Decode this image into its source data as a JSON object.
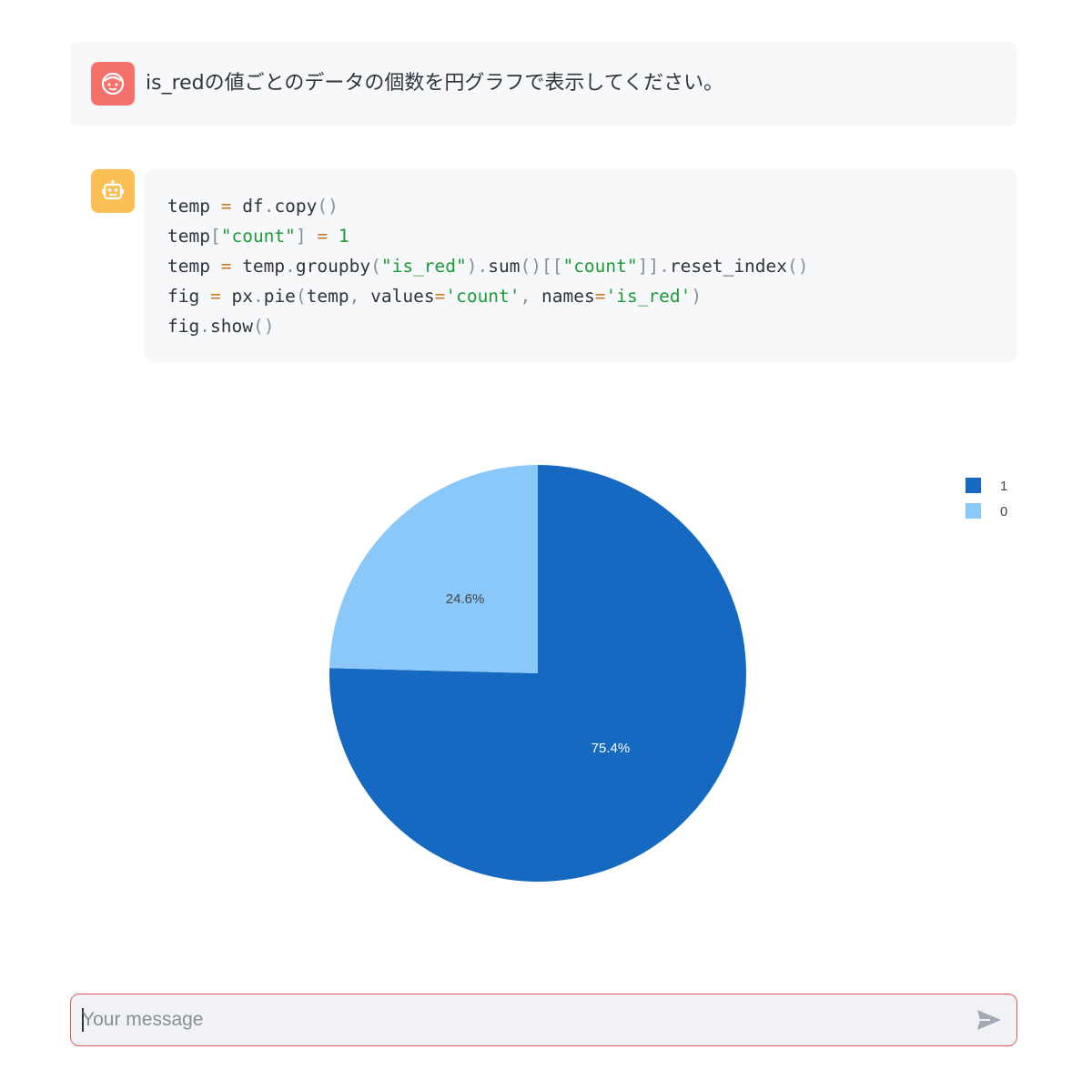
{
  "chat": {
    "user_message": "is_redの値ごとのデータの個数を円グラフで表示してください。",
    "user_avatar_icon": "face-icon",
    "bot_avatar_icon": "robot-icon",
    "code": {
      "lines": [
        [
          {
            "t": "temp ",
            "c": ""
          },
          {
            "t": "=",
            "c": "op"
          },
          {
            "t": " df",
            "c": ""
          },
          {
            "t": ".",
            "c": "punc"
          },
          {
            "t": "copy",
            "c": ""
          },
          {
            "t": "()",
            "c": "punc"
          }
        ],
        [
          {
            "t": "temp",
            "c": ""
          },
          {
            "t": "[",
            "c": "punc"
          },
          {
            "t": "\"count\"",
            "c": "str"
          },
          {
            "t": "] ",
            "c": "punc"
          },
          {
            "t": "=",
            "c": "op"
          },
          {
            "t": " ",
            "c": ""
          },
          {
            "t": "1",
            "c": "num"
          }
        ],
        [
          {
            "t": "temp ",
            "c": ""
          },
          {
            "t": "=",
            "c": "op"
          },
          {
            "t": " temp",
            "c": ""
          },
          {
            "t": ".",
            "c": "punc"
          },
          {
            "t": "groupby",
            "c": ""
          },
          {
            "t": "(",
            "c": "punc"
          },
          {
            "t": "\"is_red\"",
            "c": "str"
          },
          {
            "t": ").",
            "c": "punc"
          },
          {
            "t": "sum",
            "c": ""
          },
          {
            "t": "()[[",
            "c": "punc"
          },
          {
            "t": "\"count\"",
            "c": "str"
          },
          {
            "t": "]].",
            "c": "punc"
          },
          {
            "t": "reset_index",
            "c": ""
          },
          {
            "t": "()",
            "c": "punc"
          }
        ],
        [
          {
            "t": "fig ",
            "c": ""
          },
          {
            "t": "=",
            "c": "op"
          },
          {
            "t": " px",
            "c": ""
          },
          {
            "t": ".",
            "c": "punc"
          },
          {
            "t": "pie",
            "c": ""
          },
          {
            "t": "(",
            "c": "punc"
          },
          {
            "t": "temp",
            "c": ""
          },
          {
            "t": ", ",
            "c": "punc"
          },
          {
            "t": "values",
            "c": ""
          },
          {
            "t": "=",
            "c": "op"
          },
          {
            "t": "'count'",
            "c": "str"
          },
          {
            "t": ", ",
            "c": "punc"
          },
          {
            "t": "names",
            "c": ""
          },
          {
            "t": "=",
            "c": "op"
          },
          {
            "t": "'is_red'",
            "c": "str"
          },
          {
            "t": ")",
            "c": "punc"
          }
        ],
        [
          {
            "t": "fig",
            "c": ""
          },
          {
            "t": ".",
            "c": "punc"
          },
          {
            "t": "show",
            "c": ""
          },
          {
            "t": "()",
            "c": "punc"
          }
        ]
      ]
    }
  },
  "chart_data": {
    "type": "pie",
    "labels": [
      "1",
      "0"
    ],
    "values": [
      75.4,
      24.6
    ],
    "text_labels": [
      "75.4%",
      "24.6%"
    ],
    "colors": [
      "#1569c1",
      "#8ac8fa"
    ],
    "label_colors": [
      "#ffffff",
      "#444444"
    ],
    "legend": {
      "entries": [
        "1",
        "0"
      ],
      "placement": "top-right"
    }
  },
  "input": {
    "placeholder": "Your message",
    "send_icon": "send-icon"
  }
}
